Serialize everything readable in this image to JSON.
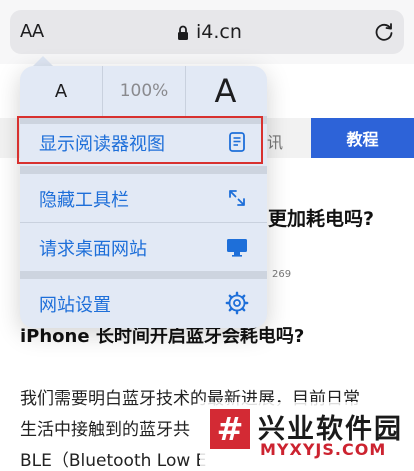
{
  "browser": {
    "text_size_button": "AA",
    "host": "i4.cn"
  },
  "page": {
    "tab_partial": "讯",
    "tab_active": "教程",
    "headline_tail": "更加耗电吗?",
    "views": "269",
    "article_title": "iPhone 长时间开启蓝牙会耗电吗?",
    "paragraph_lines": [
      "我们需要明白蓝牙技术的最新进展，目前日常",
      "生活中接触到的蓝牙共",
      "BLE（Bluetooth Low E"
    ]
  },
  "menu": {
    "font_small": "A",
    "zoom": "100%",
    "font_large": "A",
    "items": [
      {
        "label": "显示阅读器视图",
        "icon": "reader-icon"
      },
      {
        "label": "隐藏工具栏",
        "icon": "expand-arrows-icon"
      },
      {
        "label": "请求桌面网站",
        "icon": "desktop-icon"
      },
      {
        "label": "网站设置",
        "icon": "gear-icon"
      }
    ]
  },
  "watermark": {
    "logo_glyph": "#",
    "title": "兴业软件园",
    "url": "MYXYJS.COM"
  },
  "colors": {
    "accent": "#1e6fd9",
    "highlight": "#d8312f",
    "tab_active_bg": "#2d63d8"
  }
}
